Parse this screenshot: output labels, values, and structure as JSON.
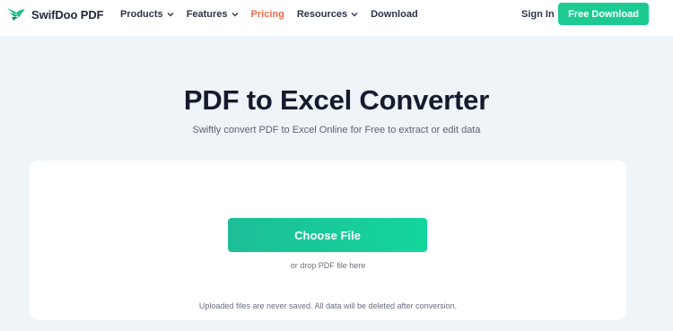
{
  "header": {
    "brand": {
      "name": "SwifDoo PDF",
      "logo_icon": "swifdoo-bird-logo-icon",
      "logo_color": "#1dbe8c"
    },
    "nav": [
      {
        "label": "Products",
        "has_dropdown": true,
        "active": false
      },
      {
        "label": "Features",
        "has_dropdown": true,
        "active": false
      },
      {
        "label": "Pricing",
        "has_dropdown": false,
        "active": true
      },
      {
        "label": "Resources",
        "has_dropdown": true,
        "active": false
      },
      {
        "label": "Download",
        "has_dropdown": false,
        "active": false
      }
    ],
    "sign_in_label": "Sign In",
    "cta_label": "Free Download"
  },
  "hero": {
    "title": "PDF to Excel Converter",
    "subtitle": "Swiftly convert PDF to Excel Online for Free to extract or edit data"
  },
  "upload": {
    "button_label": "Choose File",
    "drop_hint": "or drop PDF file here",
    "privacy_note": "Uploaded files are never saved. All data will be deleted after conversion."
  },
  "colors": {
    "accent_green": "#1dcb92",
    "active_nav": "#f06a4d",
    "page_background": "#eef4f8",
    "title_text": "#151a2e"
  }
}
